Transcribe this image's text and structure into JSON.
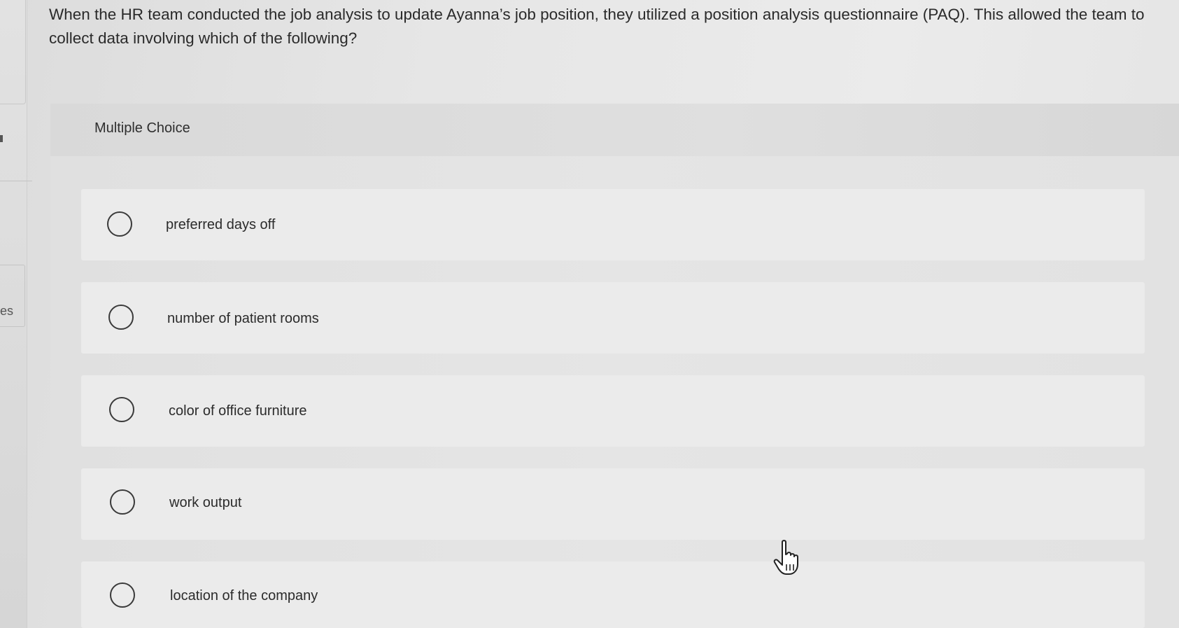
{
  "sidebar": {
    "partial_label": "es"
  },
  "question": {
    "text": "When the HR team conducted the job analysis to update Ayanna’s job position, they utilized a position analysis questionnaire (PAQ). This allowed the team to collect data involving which of the following?"
  },
  "choice_panel": {
    "header": "Multiple Choice",
    "options": [
      {
        "label": "preferred days off",
        "selected": false
      },
      {
        "label": "number of patient rooms",
        "selected": false
      },
      {
        "label": "color of office furniture",
        "selected": false
      },
      {
        "label": "work output",
        "selected": false
      },
      {
        "label": "location of the company",
        "selected": false
      }
    ]
  },
  "icons": {
    "cursor": "hand-pointer-icon",
    "radio": "radio-unchecked-icon"
  }
}
